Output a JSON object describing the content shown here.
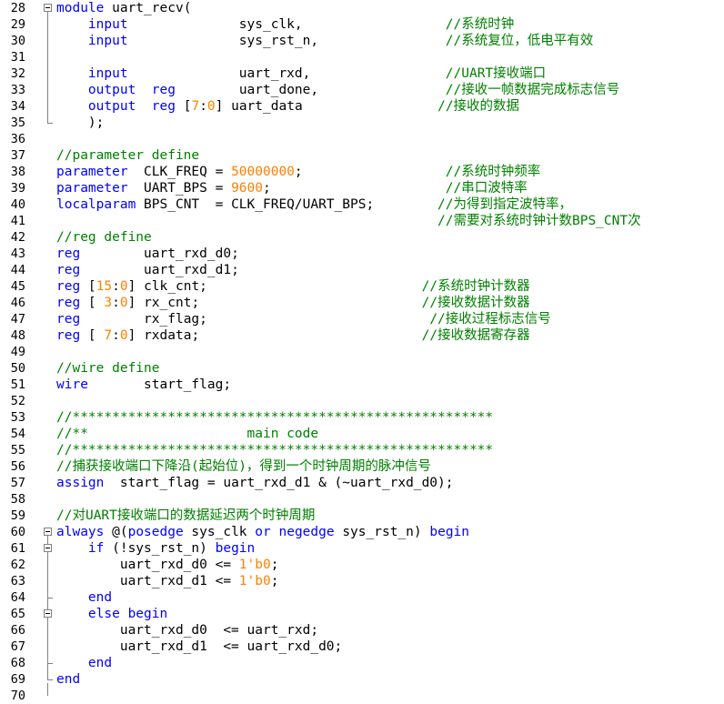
{
  "editor": {
    "language": "verilog",
    "colors": {
      "keyword": "#0000ff",
      "comment": "#008000",
      "number": "#ff8000",
      "text": "#000000",
      "fold_marker": "#808080"
    },
    "lines": [
      {
        "n": "28",
        "tokens": [
          {
            "t": "kw",
            "v": "module"
          },
          {
            "t": "tx",
            "v": " uart_recv("
          }
        ]
      },
      {
        "n": "29",
        "tokens": [
          {
            "t": "tx",
            "v": "    "
          },
          {
            "t": "kw",
            "v": "input"
          },
          {
            "t": "tx",
            "v": "              sys_clk,                  "
          },
          {
            "t": "cm",
            "v": "//系统时钟"
          }
        ]
      },
      {
        "n": "30",
        "tokens": [
          {
            "t": "tx",
            "v": "    "
          },
          {
            "t": "kw",
            "v": "input"
          },
          {
            "t": "tx",
            "v": "              sys_rst_n,                "
          },
          {
            "t": "cm",
            "v": "//系统复位，低电平有效"
          }
        ]
      },
      {
        "n": "31",
        "tokens": []
      },
      {
        "n": "32",
        "tokens": [
          {
            "t": "tx",
            "v": "    "
          },
          {
            "t": "kw",
            "v": "input"
          },
          {
            "t": "tx",
            "v": "              uart_rxd,                 "
          },
          {
            "t": "cm",
            "v": "//UART接收端口"
          }
        ]
      },
      {
        "n": "33",
        "tokens": [
          {
            "t": "tx",
            "v": "    "
          },
          {
            "t": "kw",
            "v": "output"
          },
          {
            "t": "tx",
            "v": "  "
          },
          {
            "t": "kw",
            "v": "reg"
          },
          {
            "t": "tx",
            "v": "        uart_done,                "
          },
          {
            "t": "cm",
            "v": "//接收一帧数据完成标志信号"
          }
        ]
      },
      {
        "n": "34",
        "tokens": [
          {
            "t": "tx",
            "v": "    "
          },
          {
            "t": "kw",
            "v": "output"
          },
          {
            "t": "tx",
            "v": "  "
          },
          {
            "t": "kw",
            "v": "reg"
          },
          {
            "t": "tx",
            "v": " ["
          },
          {
            "t": "num",
            "v": "7"
          },
          {
            "t": "tx",
            "v": ":"
          },
          {
            "t": "num",
            "v": "0"
          },
          {
            "t": "tx",
            "v": "] uart_data                 "
          },
          {
            "t": "cm",
            "v": "//接收的数据"
          }
        ]
      },
      {
        "n": "35",
        "tokens": [
          {
            "t": "tx",
            "v": "    );"
          }
        ]
      },
      {
        "n": "36",
        "tokens": []
      },
      {
        "n": "37",
        "tokens": [
          {
            "t": "cm",
            "v": "//parameter define"
          }
        ]
      },
      {
        "n": "38",
        "tokens": [
          {
            "t": "kw",
            "v": "parameter"
          },
          {
            "t": "tx",
            "v": "  CLK_FREQ = "
          },
          {
            "t": "num",
            "v": "50000000"
          },
          {
            "t": "tx",
            "v": ";                  "
          },
          {
            "t": "cm",
            "v": "//系统时钟频率"
          }
        ]
      },
      {
        "n": "39",
        "tokens": [
          {
            "t": "kw",
            "v": "parameter"
          },
          {
            "t": "tx",
            "v": "  UART_BPS = "
          },
          {
            "t": "num",
            "v": "9600"
          },
          {
            "t": "tx",
            "v": ";                      "
          },
          {
            "t": "cm",
            "v": "//串口波特率"
          }
        ]
      },
      {
        "n": "40",
        "tokens": [
          {
            "t": "kw",
            "v": "localparam"
          },
          {
            "t": "tx",
            "v": " BPS_CNT  = CLK_FREQ/UART_BPS;        "
          },
          {
            "t": "cm",
            "v": "//为得到指定波特率，"
          }
        ]
      },
      {
        "n": "41",
        "tokens": [
          {
            "t": "tx",
            "v": "                                                "
          },
          {
            "t": "cm",
            "v": "//需要对系统时钟计数BPS_CNT次"
          }
        ]
      },
      {
        "n": "42",
        "tokens": [
          {
            "t": "cm",
            "v": "//reg define"
          }
        ]
      },
      {
        "n": "43",
        "tokens": [
          {
            "t": "kw",
            "v": "reg"
          },
          {
            "t": "tx",
            "v": "        uart_rxd_d0;"
          }
        ]
      },
      {
        "n": "44",
        "tokens": [
          {
            "t": "kw",
            "v": "reg"
          },
          {
            "t": "tx",
            "v": "        uart_rxd_d1;"
          }
        ]
      },
      {
        "n": "45",
        "tokens": [
          {
            "t": "kw",
            "v": "reg"
          },
          {
            "t": "tx",
            "v": " ["
          },
          {
            "t": "num",
            "v": "15"
          },
          {
            "t": "tx",
            "v": ":"
          },
          {
            "t": "num",
            "v": "0"
          },
          {
            "t": "tx",
            "v": "] clk_cnt;                           "
          },
          {
            "t": "cm",
            "v": "//系统时钟计数器"
          }
        ]
      },
      {
        "n": "46",
        "tokens": [
          {
            "t": "kw",
            "v": "reg"
          },
          {
            "t": "tx",
            "v": " [ "
          },
          {
            "t": "num",
            "v": "3"
          },
          {
            "t": "tx",
            "v": ":"
          },
          {
            "t": "num",
            "v": "0"
          },
          {
            "t": "tx",
            "v": "] rx_cnt;                            "
          },
          {
            "t": "cm",
            "v": "//接收数据计数器"
          }
        ]
      },
      {
        "n": "47",
        "tokens": [
          {
            "t": "kw",
            "v": "reg"
          },
          {
            "t": "tx",
            "v": "        rx_flag;                            "
          },
          {
            "t": "cm",
            "v": "//接收过程标志信号"
          }
        ]
      },
      {
        "n": "48",
        "tokens": [
          {
            "t": "kw",
            "v": "reg"
          },
          {
            "t": "tx",
            "v": " [ "
          },
          {
            "t": "num",
            "v": "7"
          },
          {
            "t": "tx",
            "v": ":"
          },
          {
            "t": "num",
            "v": "0"
          },
          {
            "t": "tx",
            "v": "] rxdata;                            "
          },
          {
            "t": "cm",
            "v": "//接收数据寄存器"
          }
        ]
      },
      {
        "n": "49",
        "tokens": []
      },
      {
        "n": "50",
        "tokens": [
          {
            "t": "cm",
            "v": "//wire define"
          }
        ]
      },
      {
        "n": "51",
        "tokens": [
          {
            "t": "kw",
            "v": "wire"
          },
          {
            "t": "tx",
            "v": "       start_flag;"
          }
        ]
      },
      {
        "n": "52",
        "tokens": []
      },
      {
        "n": "53",
        "tokens": [
          {
            "t": "cm",
            "v": "//*****************************************************"
          }
        ]
      },
      {
        "n": "54",
        "tokens": [
          {
            "t": "cm",
            "v": "//**                    main code"
          }
        ]
      },
      {
        "n": "55",
        "tokens": [
          {
            "t": "cm",
            "v": "//*****************************************************"
          }
        ]
      },
      {
        "n": "56",
        "tokens": [
          {
            "t": "cm",
            "v": "//捕获接收端口下降沿(起始位)，得到一个时钟周期的脉冲信号"
          }
        ]
      },
      {
        "n": "57",
        "tokens": [
          {
            "t": "kw",
            "v": "assign"
          },
          {
            "t": "tx",
            "v": "  start_flag = uart_rxd_d1 & (~uart_rxd_d0);"
          }
        ]
      },
      {
        "n": "58",
        "tokens": []
      },
      {
        "n": "59",
        "tokens": [
          {
            "t": "cm",
            "v": "//对UART接收端口的数据延迟两个时钟周期"
          }
        ]
      },
      {
        "n": "60",
        "tokens": [
          {
            "t": "kw",
            "v": "always"
          },
          {
            "t": "tx",
            "v": " @("
          },
          {
            "t": "kw",
            "v": "posedge"
          },
          {
            "t": "tx",
            "v": " sys_clk "
          },
          {
            "t": "kw",
            "v": "or"
          },
          {
            "t": "tx",
            "v": " "
          },
          {
            "t": "kw",
            "v": "negedge"
          },
          {
            "t": "tx",
            "v": " sys_rst_n) "
          },
          {
            "t": "kw",
            "v": "begin"
          }
        ]
      },
      {
        "n": "61",
        "tokens": [
          {
            "t": "tx",
            "v": "    "
          },
          {
            "t": "kw",
            "v": "if"
          },
          {
            "t": "tx",
            "v": " (!sys_rst_n) "
          },
          {
            "t": "kw",
            "v": "begin"
          }
        ]
      },
      {
        "n": "62",
        "tokens": [
          {
            "t": "tx",
            "v": "        uart_rxd_d0 <= "
          },
          {
            "t": "num",
            "v": "1'b0"
          },
          {
            "t": "tx",
            "v": ";"
          }
        ]
      },
      {
        "n": "63",
        "tokens": [
          {
            "t": "tx",
            "v": "        uart_rxd_d1 <= "
          },
          {
            "t": "num",
            "v": "1'b0"
          },
          {
            "t": "tx",
            "v": ";"
          }
        ]
      },
      {
        "n": "64",
        "tokens": [
          {
            "t": "tx",
            "v": "    "
          },
          {
            "t": "kw",
            "v": "end"
          }
        ]
      },
      {
        "n": "65",
        "tokens": [
          {
            "t": "tx",
            "v": "    "
          },
          {
            "t": "kw",
            "v": "else"
          },
          {
            "t": "tx",
            "v": " "
          },
          {
            "t": "kw",
            "v": "begin"
          }
        ]
      },
      {
        "n": "66",
        "tokens": [
          {
            "t": "tx",
            "v": "        uart_rxd_d0  <= uart_rxd;"
          }
        ]
      },
      {
        "n": "67",
        "tokens": [
          {
            "t": "tx",
            "v": "        uart_rxd_d1  <= uart_rxd_d0;"
          }
        ]
      },
      {
        "n": "68",
        "tokens": [
          {
            "t": "tx",
            "v": "    "
          },
          {
            "t": "kw",
            "v": "end"
          }
        ]
      },
      {
        "n": "69",
        "tokens": [
          {
            "t": "kw",
            "v": "end"
          }
        ]
      },
      {
        "n": "70",
        "tokens": []
      }
    ]
  }
}
